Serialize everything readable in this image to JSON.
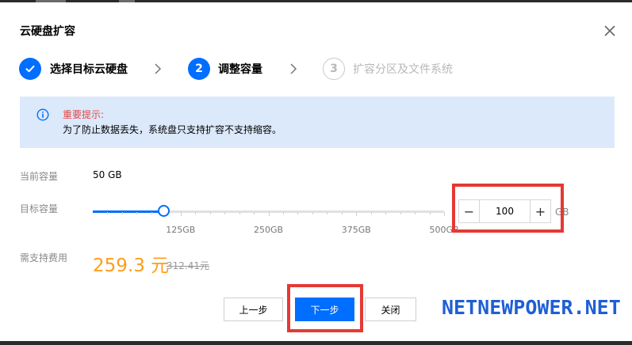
{
  "dialog": {
    "title": "云硬盘扩容"
  },
  "steps": [
    {
      "label": "选择目标云硬盘",
      "icon": "check-icon",
      "state": "done"
    },
    {
      "label": "调整容量",
      "number": "2",
      "state": "active"
    },
    {
      "label": "扩容分区及文件系统",
      "number": "3",
      "state": "pending"
    }
  ],
  "notice": {
    "title": "重要提示:",
    "text": "为了防止数据丢失，系统盘只支持扩容不支持缩容。",
    "icon": "info-icon"
  },
  "form": {
    "current_label": "当前容量",
    "current_value": "50 GB",
    "target_label": "目标容量",
    "slider": {
      "min": 0,
      "max": 500,
      "value": 100,
      "ticks": [
        "125GB",
        "250GB",
        "375GB",
        "500GB"
      ]
    },
    "stepper": {
      "value": "100",
      "minus": "−",
      "plus": "+"
    },
    "unit": "GB",
    "fee_label": "需支持费用",
    "price": "259.3 元",
    "original_price": "312.41元"
  },
  "buttons": {
    "prev": "上一步",
    "next": "下一步",
    "close": "关闭"
  },
  "watermark": "NETNEWPOWER.NET",
  "colors": {
    "primary": "#006eff",
    "price": "#ff9c19",
    "warning": "#e54545",
    "highlight": "#e53935",
    "notice_bg": "#dbe9fb"
  }
}
